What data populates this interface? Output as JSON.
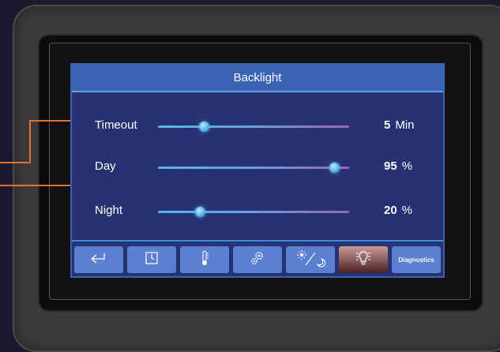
{
  "screen": {
    "title": "Backlight",
    "settings": [
      {
        "id": "timeout",
        "label": "Timeout",
        "value": "5",
        "unit": "Min",
        "level": 0.24
      },
      {
        "id": "day",
        "label": "Day",
        "value": "95",
        "unit": "%",
        "level": 0.92
      },
      {
        "id": "night",
        "label": "Night",
        "value": "20",
        "unit": "%",
        "level": 0.22
      }
    ],
    "toolbar": [
      {
        "id": "back",
        "icon": "back-arrow-icon"
      },
      {
        "id": "clock",
        "icon": "clock-icon"
      },
      {
        "id": "temperature",
        "icon": "thermometer-icon"
      },
      {
        "id": "settings",
        "icon": "gears-icon"
      },
      {
        "id": "daynight",
        "icon": "sun-moon-icon"
      },
      {
        "id": "backlight",
        "icon": "light-bulb-icon",
        "active": true
      },
      {
        "id": "diagnostics",
        "label": "Diagnostics"
      }
    ]
  },
  "colors": {
    "screen_bg": "#263271",
    "title_bg": "#3a63b5",
    "button_bg": "#5c7fd0",
    "active_button": "#7a3c40",
    "callout_lines": "#e07232"
  }
}
